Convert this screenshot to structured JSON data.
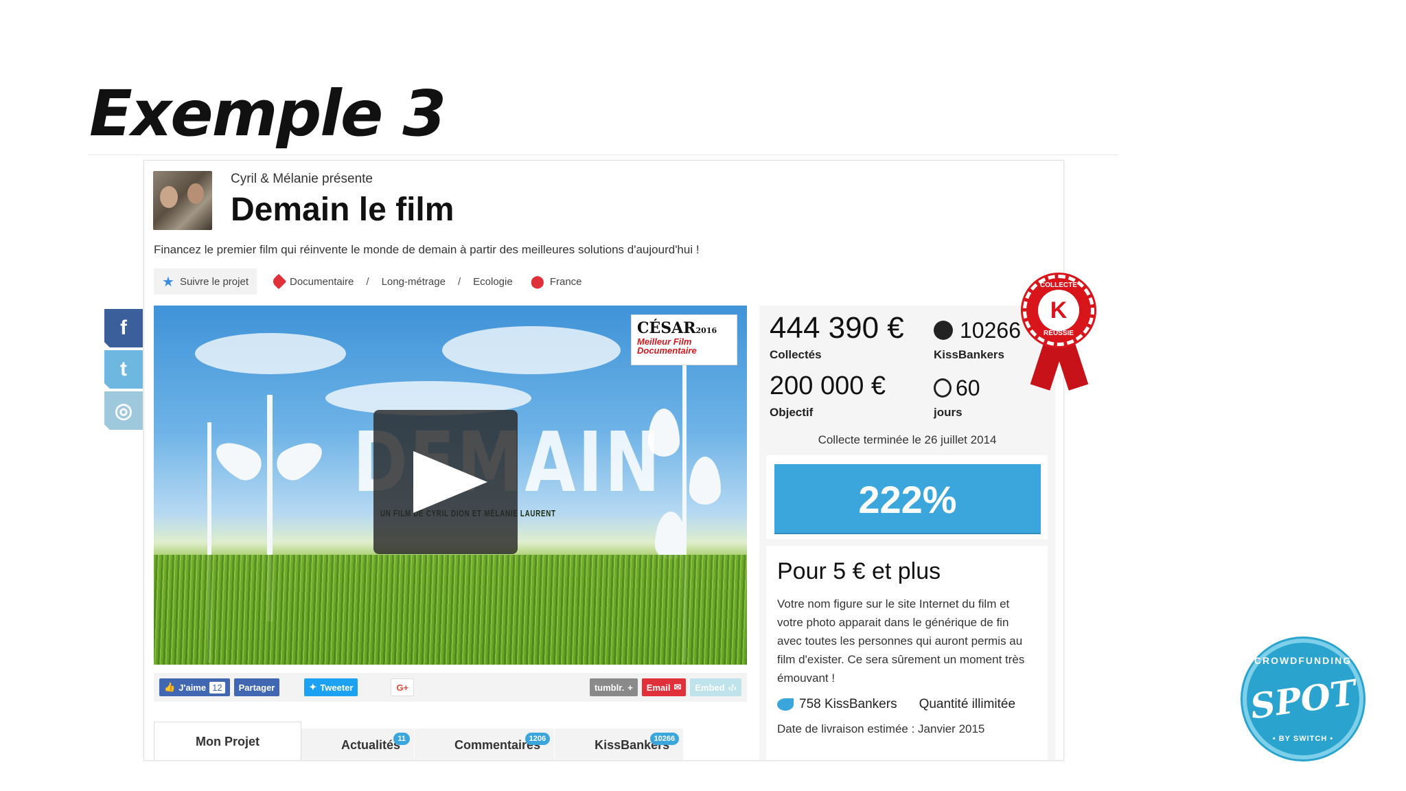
{
  "slide": {
    "title": "Exemple 3"
  },
  "project": {
    "presenter": "Cyril & Mélanie présente",
    "title": "Demain le film",
    "tagline": "Financez le premier film qui réinvente le monde de demain à partir des meilleures solutions d'aujourd'hui !",
    "follow_label": "Suivre le projet",
    "categories": [
      "Documentaire",
      "Long-métrage",
      "Ecologie"
    ],
    "location": "France"
  },
  "video": {
    "overlay_title": "DEMAIN",
    "overlay_subtitle": "UN FILM DE CYRIL DION ET MÉLANIE LAURENT",
    "award_line1": "CÉSAR",
    "award_year": "2016",
    "award_line2": "Meilleur Film",
    "award_line3": "Documentaire"
  },
  "share": {
    "like_label": "J'aime",
    "like_count": "12",
    "share_label": "Partager",
    "tweet_label": "Tweeter",
    "gplus_label": "G+",
    "tumblr_label": "tumblr.",
    "email_label": "Email",
    "embed_label": "Embed"
  },
  "tabs": [
    {
      "label": "Mon Projet",
      "badge": ""
    },
    {
      "label": "Actualités",
      "badge": "11"
    },
    {
      "label": "Commentaires",
      "badge": "1206"
    },
    {
      "label": "KissBankers",
      "badge": "10266"
    }
  ],
  "stats": {
    "collected": "444 390 €",
    "collected_label": "Collectés",
    "backers": "10266",
    "backers_label": "KissBankers",
    "goal": "200 000 €",
    "goal_label": "Objectif",
    "days": "60",
    "days_label": "jours",
    "ended_text": "Collecte terminée le 26 juillet 2014",
    "progress_percent": "222%",
    "progress_value": 2.22
  },
  "badge_ribbon": {
    "text_top": "COLLECTE",
    "text_bottom": "RÉUSSIE"
  },
  "reward": {
    "title": "Pour 5 € et plus",
    "description": "Votre nom figure sur le site Internet du film et votre photo apparait dans le générique de fin avec toutes les personnes qui auront permis au film d'exister. Ce sera sûrement un moment très émouvant !",
    "backers": "758 KissBankers",
    "quantity": "Quantité illimitée",
    "delivery": "Date de livraison estimée : Janvier 2015"
  },
  "spot_logo": {
    "ring": "CROWDFUNDING",
    "main": "SPOT",
    "by": "• BY SWITCH •"
  },
  "colors": {
    "accent": "#3aa6dc",
    "facebook": "#4267b2",
    "twitter": "#1da1f2",
    "danger": "#e0303a"
  },
  "icons": [
    "star-icon",
    "tag-icon",
    "location-pin-icon",
    "play-icon",
    "facebook-icon",
    "twitter-icon",
    "globe-icon",
    "kissbankers-icon",
    "stopwatch-icon"
  ]
}
